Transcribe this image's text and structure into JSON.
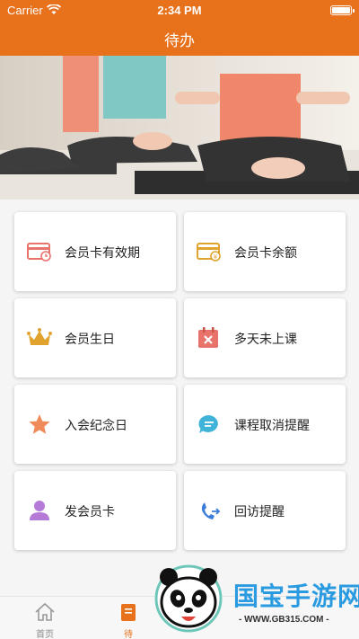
{
  "status": {
    "carrier": "Carrier",
    "time": "2:34 PM"
  },
  "nav": {
    "title": "待办"
  },
  "cards": [
    {
      "label": "会员卡有效期",
      "icon": "card-expiry-icon"
    },
    {
      "label": "会员卡余额",
      "icon": "card-balance-icon"
    },
    {
      "label": "会员生日",
      "icon": "crown-icon"
    },
    {
      "label": "多天未上课",
      "icon": "calendar-x-icon"
    },
    {
      "label": "入会纪念日",
      "icon": "star-icon"
    },
    {
      "label": "课程取消提醒",
      "icon": "chat-bubble-icon"
    },
    {
      "label": "发会员卡",
      "icon": "person-icon"
    },
    {
      "label": "回访提醒",
      "icon": "phone-callback-icon"
    }
  ],
  "tabs": [
    {
      "label": "首页",
      "icon": "home-icon"
    },
    {
      "label": "待",
      "icon": "todo-icon"
    }
  ],
  "watermark": {
    "title": "国宝手游网",
    "url": "- WWW.GB315.COM -"
  },
  "colors": {
    "brand": "#e8711c",
    "card_red": "#e8736a",
    "gold": "#e0a32e",
    "blue": "#3b7dd8",
    "purple": "#b57ad8"
  }
}
